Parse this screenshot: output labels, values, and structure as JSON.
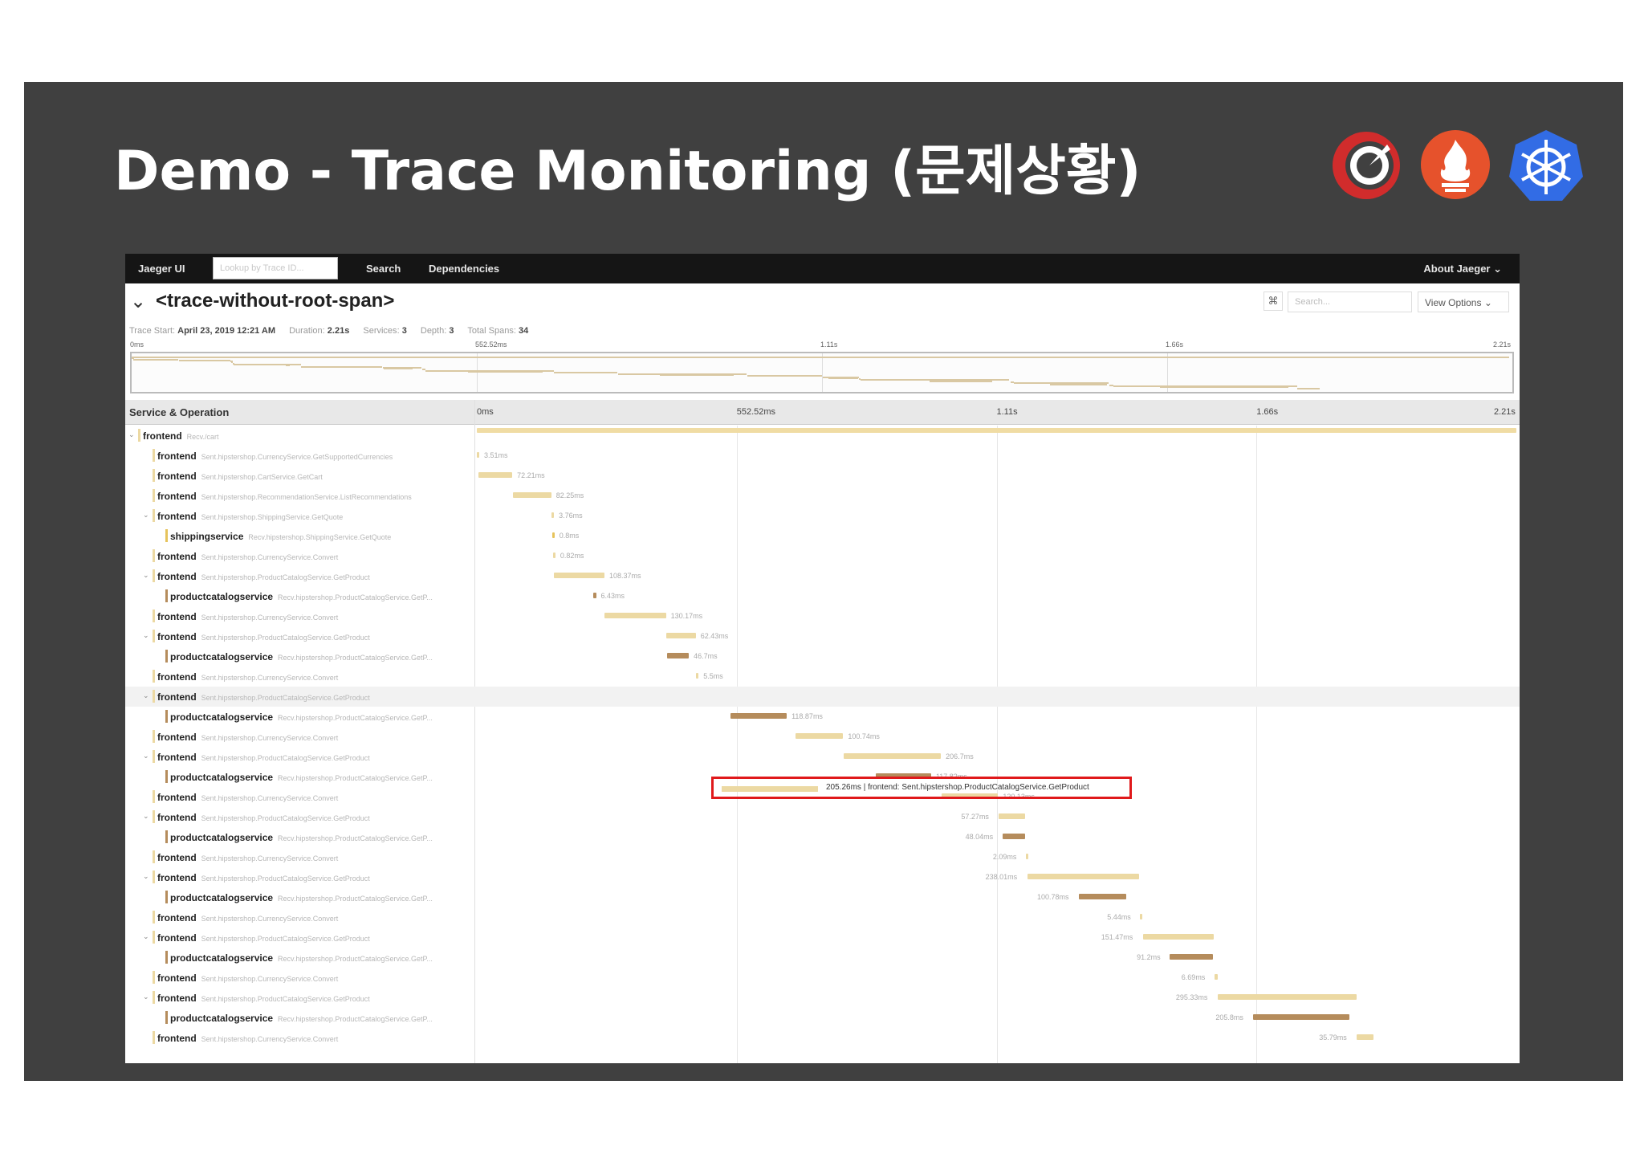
{
  "slide": {
    "title": "Demo - Trace Monitoring (문제상황)"
  },
  "logos": [
    {
      "name": "jaeger-logo",
      "color": "#d12c2c"
    },
    {
      "name": "prometheus-logo",
      "color": "#e6522c"
    },
    {
      "name": "kubernetes-logo",
      "color": "#326ce5"
    }
  ],
  "topnav": {
    "brand": "Jaeger UI",
    "lookup_placeholder": "Lookup by Trace ID...",
    "search": "Search",
    "dependencies": "Dependencies",
    "about": "About Jaeger ⌄"
  },
  "trace": {
    "title": "<trace-without-root-span>",
    "find_placeholder": "Search...",
    "view_options": "View Options ⌄",
    "meta": {
      "trace_start_label": "Trace Start",
      "trace_start": "April 23, 2019 12:21 AM",
      "duration_label": "Duration",
      "duration": "2.21s",
      "services_label": "Services",
      "services": "3",
      "depth_label": "Depth",
      "depth": "3",
      "total_spans_label": "Total Spans",
      "total_spans": "34"
    }
  },
  "timeline": {
    "header_label": "Service & Operation",
    "ticks": [
      "0ms",
      "552.52ms",
      "1.11s",
      "1.66s",
      "2.21s"
    ],
    "total_ms": 2210
  },
  "colors": {
    "frontend": "#ecd9a3",
    "productcatalogservice": "#b58c5c",
    "shippingservice": "#e6c35c",
    "callout": "#e0191b"
  },
  "callout": {
    "text": "205.26ms | frontend: Sent.hipstershop.ProductCatalogService.GetProduct"
  },
  "spans": [
    {
      "depth": 0,
      "toggle": true,
      "service": "frontend",
      "op": "Recv./cart",
      "start": 0,
      "dur": 2210,
      "label": ""
    },
    {
      "depth": 1,
      "toggle": false,
      "service": "frontend",
      "op": "Sent.hipstershop.CurrencyService.GetSupportedCurrencies",
      "start": 0,
      "dur": 3.51,
      "label": "3.51ms"
    },
    {
      "depth": 1,
      "toggle": false,
      "service": "frontend",
      "op": "Sent.hipstershop.CartService.GetCart",
      "start": 3,
      "dur": 72.21,
      "label": "72.21ms"
    },
    {
      "depth": 1,
      "toggle": false,
      "service": "frontend",
      "op": "Sent.hipstershop.RecommendationService.ListRecommendations",
      "start": 76,
      "dur": 82.25,
      "label": "82.25ms"
    },
    {
      "depth": 1,
      "toggle": true,
      "service": "frontend",
      "op": "Sent.hipstershop.ShippingService.GetQuote",
      "start": 159,
      "dur": 3.76,
      "label": "3.76ms"
    },
    {
      "depth": 2,
      "toggle": false,
      "service": "shippingservice",
      "op": "Recv.hipstershop.ShippingService.GetQuote",
      "start": 160,
      "dur": 0.8,
      "label": "0.8ms"
    },
    {
      "depth": 1,
      "toggle": false,
      "service": "frontend",
      "op": "Sent.hipstershop.CurrencyService.Convert",
      "start": 162,
      "dur": 0.82,
      "label": "0.82ms"
    },
    {
      "depth": 1,
      "toggle": true,
      "service": "frontend",
      "op": "Sent.hipstershop.ProductCatalogService.GetProduct",
      "start": 163,
      "dur": 108.37,
      "label": "108.37ms"
    },
    {
      "depth": 2,
      "toggle": false,
      "service": "productcatalogservice",
      "op": "Recv.hipstershop.ProductCatalogService.GetP...",
      "start": 247,
      "dur": 6.43,
      "label": "6.43ms"
    },
    {
      "depth": 1,
      "toggle": false,
      "service": "frontend",
      "op": "Sent.hipstershop.CurrencyService.Convert",
      "start": 272,
      "dur": 130.17,
      "label": "130.17ms"
    },
    {
      "depth": 1,
      "toggle": true,
      "service": "frontend",
      "op": "Sent.hipstershop.ProductCatalogService.GetProduct",
      "start": 403,
      "dur": 62.43,
      "label": "62.43ms"
    },
    {
      "depth": 2,
      "toggle": false,
      "service": "productcatalogservice",
      "op": "Recv.hipstershop.ProductCatalogService.GetP...",
      "start": 404,
      "dur": 46.7,
      "label": "46.7ms"
    },
    {
      "depth": 1,
      "toggle": false,
      "service": "frontend",
      "op": "Sent.hipstershop.CurrencyService.Convert",
      "start": 466,
      "dur": 5.5,
      "label": "5.5ms"
    },
    {
      "depth": 1,
      "toggle": true,
      "service": "frontend",
      "op": "Sent.hipstershop.ProductCatalogService.GetProduct",
      "start": 472,
      "dur": 205.26,
      "label": "",
      "highlight": true
    },
    {
      "depth": 2,
      "toggle": false,
      "service": "productcatalogservice",
      "op": "Recv.hipstershop.ProductCatalogService.GetP...",
      "start": 540,
      "dur": 118.87,
      "label": "118.87ms"
    },
    {
      "depth": 1,
      "toggle": false,
      "service": "frontend",
      "op": "Sent.hipstershop.CurrencyService.Convert",
      "start": 678,
      "dur": 100.74,
      "label": "100.74ms"
    },
    {
      "depth": 1,
      "toggle": true,
      "service": "frontend",
      "op": "Sent.hipstershop.ProductCatalogService.GetProduct",
      "start": 780,
      "dur": 206.7,
      "label": "206.7ms"
    },
    {
      "depth": 2,
      "toggle": false,
      "service": "productcatalogservice",
      "op": "Recv.hipstershop.ProductCatalogService.GetP...",
      "start": 848,
      "dur": 117.82,
      "label": "117.82ms"
    },
    {
      "depth": 1,
      "toggle": false,
      "service": "frontend",
      "op": "Sent.hipstershop.CurrencyService.Convert",
      "start": 988,
      "dur": 120.13,
      "label": "120.13ms"
    },
    {
      "depth": 1,
      "toggle": true,
      "service": "frontend",
      "op": "Sent.hipstershop.ProductCatalogService.GetProduct",
      "start": 1109,
      "dur": 57.27,
      "label": "57.27ms",
      "label_left": true
    },
    {
      "depth": 2,
      "toggle": false,
      "service": "productcatalogservice",
      "op": "Recv.hipstershop.ProductCatalogService.GetP...",
      "start": 1118,
      "dur": 48.04,
      "label": "48.04ms",
      "label_left": true
    },
    {
      "depth": 1,
      "toggle": false,
      "service": "frontend",
      "op": "Sent.hipstershop.CurrencyService.Convert",
      "start": 1167,
      "dur": 2.09,
      "label": "2.09ms",
      "label_left": true
    },
    {
      "depth": 1,
      "toggle": true,
      "service": "frontend",
      "op": "Sent.hipstershop.ProductCatalogService.GetProduct",
      "start": 1170,
      "dur": 238.01,
      "label": "238.01ms",
      "label_left": true
    },
    {
      "depth": 2,
      "toggle": false,
      "service": "productcatalogservice",
      "op": "Recv.hipstershop.ProductCatalogService.GetP...",
      "start": 1280,
      "dur": 100.78,
      "label": "100.78ms",
      "label_left": true
    },
    {
      "depth": 1,
      "toggle": false,
      "service": "frontend",
      "op": "Sent.hipstershop.CurrencyService.Convert",
      "start": 1410,
      "dur": 5.44,
      "label": "5.44ms",
      "label_left": true
    },
    {
      "depth": 1,
      "toggle": true,
      "service": "frontend",
      "op": "Sent.hipstershop.ProductCatalogService.GetProduct",
      "start": 1416,
      "dur": 151.47,
      "label": "151.47ms",
      "label_left": true
    },
    {
      "depth": 2,
      "toggle": false,
      "service": "productcatalogservice",
      "op": "Recv.hipstershop.ProductCatalogService.GetP...",
      "start": 1473,
      "dur": 91.2,
      "label": "91.2ms",
      "label_left": true
    },
    {
      "depth": 1,
      "toggle": false,
      "service": "frontend",
      "op": "Sent.hipstershop.CurrencyService.Convert",
      "start": 1568,
      "dur": 6.69,
      "label": "6.69ms",
      "label_left": true
    },
    {
      "depth": 1,
      "toggle": true,
      "service": "frontend",
      "op": "Sent.hipstershop.ProductCatalogService.GetProduct",
      "start": 1575,
      "dur": 295.33,
      "label": "295.33ms",
      "label_left": true
    },
    {
      "depth": 2,
      "toggle": false,
      "service": "productcatalogservice",
      "op": "Recv.hipstershop.ProductCatalogService.GetP...",
      "start": 1650,
      "dur": 205.8,
      "label": "205.8ms",
      "label_left": true
    },
    {
      "depth": 1,
      "toggle": false,
      "service": "frontend",
      "op": "Sent.hipstershop.CurrencyService.Convert",
      "start": 1870,
      "dur": 35.79,
      "label": "35.79ms",
      "label_left": true
    }
  ]
}
